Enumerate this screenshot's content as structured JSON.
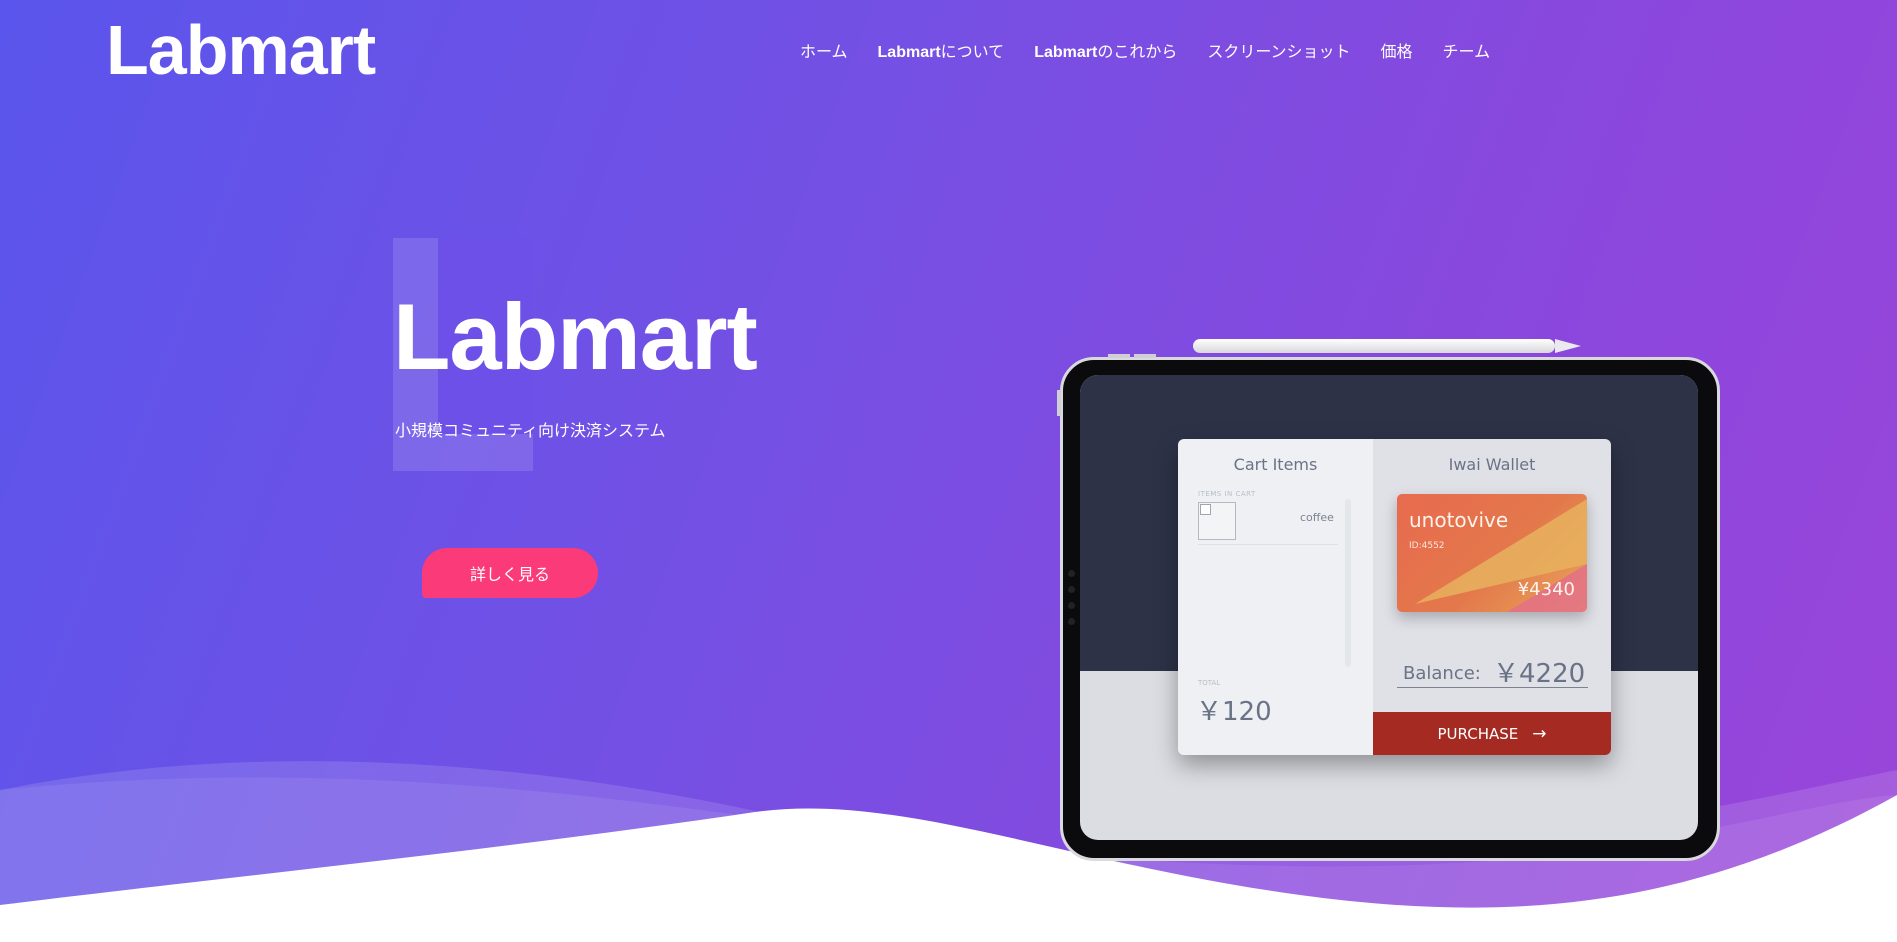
{
  "header": {
    "logo": "Labmart",
    "nav": [
      {
        "bold": "",
        "text": "ホーム"
      },
      {
        "bold": "Labmart",
        "text": "について"
      },
      {
        "bold": "Labmart",
        "text": "のこれから"
      },
      {
        "bold": "",
        "text": "スクリーンショット"
      },
      {
        "bold": "",
        "text": "価格"
      },
      {
        "bold": "",
        "text": "チーム"
      }
    ]
  },
  "hero": {
    "title": "Labmart",
    "subtitle": "小規模コミュニティ向け決済システム",
    "cta_label": "詳しく見る"
  },
  "app": {
    "cart": {
      "title": "Cart Items",
      "items_label": "ITEMS IN CART",
      "item_name": "coffee",
      "total_label": "TOTAL",
      "total_value": "￥120"
    },
    "wallet": {
      "title": "Iwai Wallet",
      "card_brand": "unotovive",
      "card_id": "ID:4552",
      "card_amount": "¥4340",
      "balance_label": "Balance:",
      "balance_value": "￥4220",
      "purchase_label": "PURCHASE",
      "purchase_arrow": "→"
    }
  },
  "colors": {
    "gradient_start": "#5a55ec",
    "gradient_end": "#9a45da",
    "cta": "#fb3a7a",
    "purchase": "#a42a22",
    "wave": "#ffffff"
  }
}
